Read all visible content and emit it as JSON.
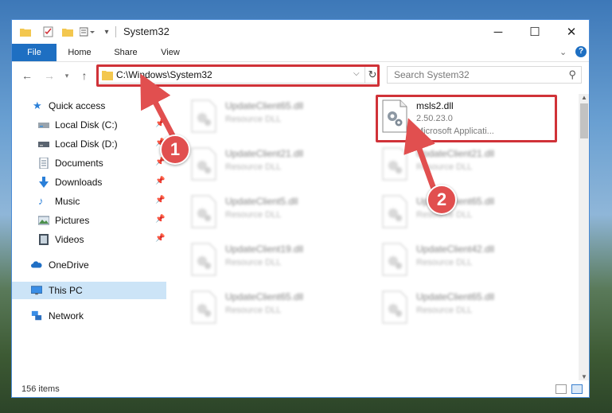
{
  "window": {
    "title": "System32"
  },
  "ribbon": {
    "tabs": [
      "File",
      "Home",
      "Share",
      "View"
    ]
  },
  "address": {
    "path": "C:\\Windows\\System32"
  },
  "search": {
    "placeholder": "Search System32"
  },
  "sidebar": {
    "items": [
      {
        "label": "Quick access",
        "icon": "star-icon"
      },
      {
        "label": "Local Disk (C:)",
        "icon": "drive-icon"
      },
      {
        "label": "Local Disk (D:)",
        "icon": "drive-icon"
      },
      {
        "label": "Documents",
        "icon": "documents-icon"
      },
      {
        "label": "Downloads",
        "icon": "download-arrow-icon"
      },
      {
        "label": "Music",
        "icon": "music-icon"
      },
      {
        "label": "Pictures",
        "icon": "pictures-icon"
      },
      {
        "label": "Videos",
        "icon": "videos-icon"
      },
      {
        "label": "OneDrive",
        "icon": "cloud-icon"
      },
      {
        "label": "This PC",
        "icon": "monitor-icon"
      },
      {
        "label": "Network",
        "icon": "network-icon"
      }
    ],
    "selected": "This PC"
  },
  "files": [
    {
      "name": "UpdateClient65.dll",
      "type": "Resource DLL"
    },
    {
      "name": "msls2.dll",
      "version": "2.50.23.0",
      "description": "Microsoft Applicati..."
    },
    {
      "name": "UpdateClient21.dll",
      "type": "Resource DLL"
    },
    {
      "name": "UpdateClient21.dll",
      "type": "Resource DLL"
    },
    {
      "name": "UpdateClient5.dll",
      "type": "Resource DLL"
    },
    {
      "name": "UpdateClient65.dll",
      "type": "Resource DLL"
    },
    {
      "name": "UpdateClient19.dll",
      "type": "Resource DLL"
    },
    {
      "name": "UpdateClient42.dll",
      "type": "Resource DLL"
    },
    {
      "name": "UpdateClient65.dll",
      "type": "Resource DLL"
    },
    {
      "name": "UpdateClient65.dll",
      "type": "Resource DLL"
    }
  ],
  "status": {
    "item_count": "156 items"
  },
  "annotations": {
    "step1": "1",
    "step2": "2",
    "color": "#d03238"
  }
}
